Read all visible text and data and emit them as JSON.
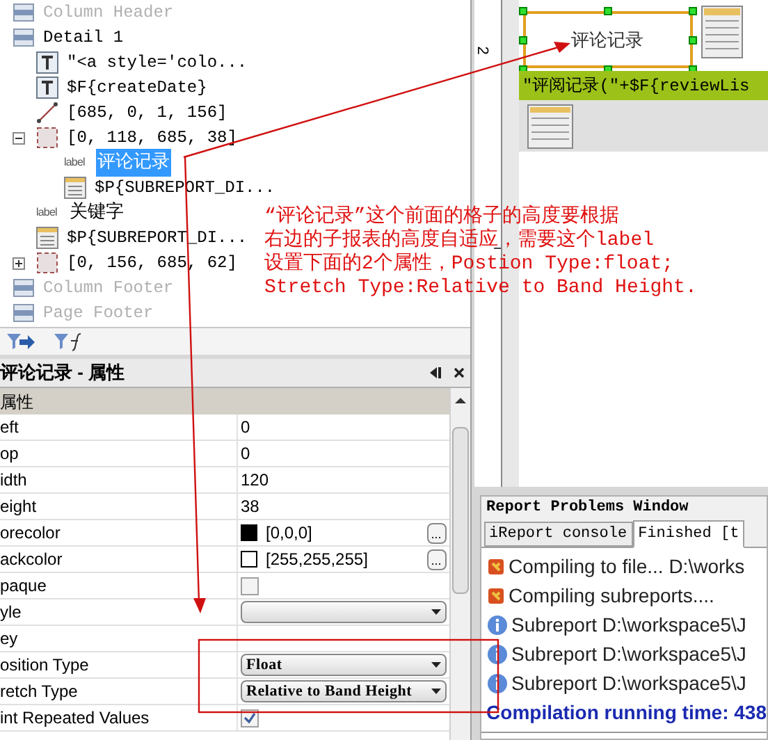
{
  "tree": [
    {
      "label": "Column Header",
      "kind": "band",
      "dimmed": true
    },
    {
      "label": "Detail 1",
      "kind": "band",
      "dimmed": false,
      "children": [
        {
          "label": "\"<a style='colo...",
          "kind": "text"
        },
        {
          "label": "$F{createDate}",
          "kind": "text"
        },
        {
          "label": "[685, 0, 1, 156]",
          "kind": "line"
        },
        {
          "label": "[0, 118, 685, 38]",
          "kind": "frame",
          "expanded": true,
          "children": [
            {
              "label": "评论记录",
              "kind": "label",
              "tag": "label",
              "selected": true
            },
            {
              "label": "$P{SUBREPORT_DI...",
              "kind": "subreport"
            }
          ]
        },
        {
          "label": "关键字",
          "kind": "label",
          "tag": "label",
          "selected": false
        },
        {
          "label": "$P{SUBREPORT_DI...",
          "kind": "subreport"
        },
        {
          "label": "[0, 156, 685, 62]",
          "kind": "frame",
          "expanded": false
        }
      ]
    },
    {
      "label": "Column Footer",
      "kind": "band",
      "dimmed": true
    },
    {
      "label": "Page Footer",
      "kind": "band",
      "dimmed": true
    }
  ],
  "properties": {
    "title": "评论记录 - 属性",
    "section": "属性",
    "rows": [
      {
        "name": "eft",
        "kind": "text",
        "value": "0"
      },
      {
        "name": "op",
        "kind": "text",
        "value": "0"
      },
      {
        "name": "idth",
        "kind": "text",
        "value": "120"
      },
      {
        "name": "eight",
        "kind": "text",
        "value": "38"
      },
      {
        "name": "orecolor",
        "kind": "color",
        "color": "#000000",
        "value": "[0,0,0]",
        "button": "..."
      },
      {
        "name": "ackcolor",
        "kind": "color",
        "color": "#ffffff",
        "value": "[255,255,255]",
        "button": "..."
      },
      {
        "name": "paque",
        "kind": "checkbox",
        "checked": false
      },
      {
        "name": "yle",
        "kind": "select"
      },
      {
        "name": "ey",
        "kind": "text"
      },
      {
        "name": "osition Type",
        "kind": "select",
        "value": "Float"
      },
      {
        "name": "retch Type",
        "kind": "select",
        "value": "Relative to Band Height"
      },
      {
        "name": "int Repeated Values",
        "kind": "checkbox",
        "checked": true
      }
    ]
  },
  "designer": {
    "ruler_label": "2",
    "element_text": "评论记录",
    "band_text": "\"评阅记录(\"+$F{reviewLis"
  },
  "problems": {
    "title": "Report Problems Window",
    "tabs": [
      {
        "label": "iReport console",
        "selected": false
      },
      {
        "label": "Finished [t",
        "selected": true
      }
    ],
    "lines": [
      {
        "kind": "compile",
        "text": "Compiling to file... D:\\works"
      },
      {
        "kind": "compile",
        "text": "Compiling subreports...."
      },
      {
        "kind": "info",
        "text": "Subreport D:\\workspace5\\J"
      },
      {
        "kind": "info",
        "text": "Subreport D:\\workspace5\\J"
      },
      {
        "kind": "info",
        "text": "Subreport D:\\workspace5\\J"
      },
      {
        "kind": "summary",
        "text": "Compilation running time: 438"
      }
    ]
  },
  "annotation": {
    "lines": [
      "“评论记录”这个前面的格子的高度要根据",
      "右边的子报表的高度自适应，需要这个label",
      "设置下面的2个属性，Postion Type:float;",
      "Stretch Type:Relative to Band Height."
    ]
  }
}
